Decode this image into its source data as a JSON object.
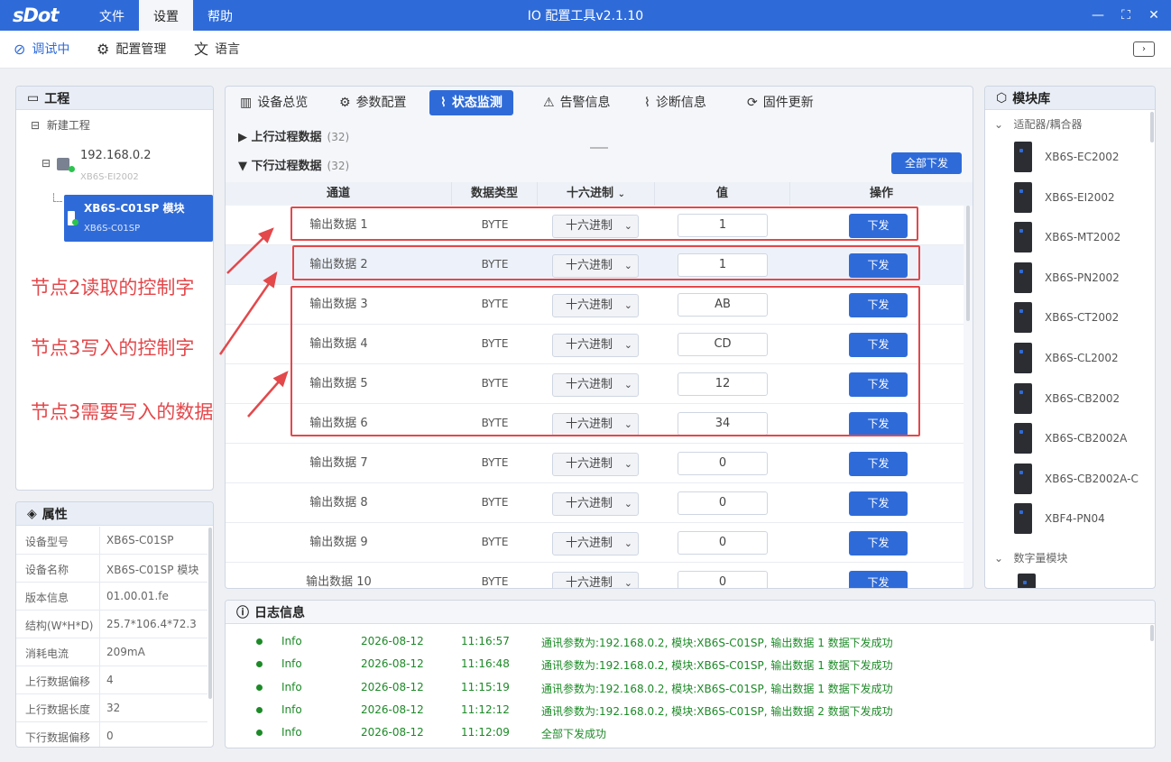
{
  "app": {
    "logo": "sDot",
    "title": "IO 配置工具v2.1.10",
    "menus": [
      "文件",
      "设置",
      "帮助"
    ],
    "active_menu": "设置"
  },
  "toolbar": {
    "debug": "调试中",
    "config_mgmt": "配置管理",
    "language": "语言"
  },
  "project": {
    "title": "工程",
    "root": "新建工程",
    "gateway_ip": "192.168.0.2",
    "gateway_model": "XB6S-EI2002",
    "selected_name": "XB6S-C01SP 模块",
    "selected_model": "XB6S-C01SP"
  },
  "properties": {
    "title": "属性",
    "rows": [
      {
        "k": "设备型号",
        "v": "XB6S-C01SP"
      },
      {
        "k": "设备名称",
        "v": "XB6S-C01SP 模块"
      },
      {
        "k": "版本信息",
        "v": "01.00.01.fe"
      },
      {
        "k": "结构(W*H*D)",
        "v": "25.7*106.4*72.3"
      },
      {
        "k": "消耗电流",
        "v": "209mA"
      },
      {
        "k": "上行数据偏移",
        "v": "4"
      },
      {
        "k": "上行数据长度",
        "v": "32"
      },
      {
        "k": "下行数据偏移",
        "v": "0"
      }
    ]
  },
  "tabs": [
    "设备总览",
    "参数配置",
    "状态监测",
    "告警信息",
    "诊断信息",
    "固件更新"
  ],
  "active_tab": "状态监测",
  "upstream": {
    "label": "上行过程数据",
    "count": "(32)"
  },
  "downstream": {
    "label": "下行过程数据",
    "count": "(32)",
    "send_all": "全部下发"
  },
  "table": {
    "headers": [
      "通道",
      "数据类型",
      "十六进制",
      "值",
      "操作"
    ],
    "rows": [
      {
        "ch": "输出数据 1",
        "type": "BYTE",
        "fmt": "十六进制",
        "val": "1",
        "op": "下发"
      },
      {
        "ch": "输出数据 2",
        "type": "BYTE",
        "fmt": "十六进制",
        "val": "1",
        "op": "下发"
      },
      {
        "ch": "输出数据 3",
        "type": "BYTE",
        "fmt": "十六进制",
        "val": "AB",
        "op": "下发"
      },
      {
        "ch": "输出数据 4",
        "type": "BYTE",
        "fmt": "十六进制",
        "val": "CD",
        "op": "下发"
      },
      {
        "ch": "输出数据 5",
        "type": "BYTE",
        "fmt": "十六进制",
        "val": "12",
        "op": "下发"
      },
      {
        "ch": "输出数据 6",
        "type": "BYTE",
        "fmt": "十六进制",
        "val": "34",
        "op": "下发"
      },
      {
        "ch": "输出数据 7",
        "type": "BYTE",
        "fmt": "十六进制",
        "val": "0",
        "op": "下发"
      },
      {
        "ch": "输出数据 8",
        "type": "BYTE",
        "fmt": "十六进制",
        "val": "0",
        "op": "下发"
      },
      {
        "ch": "输出数据 9",
        "type": "BYTE",
        "fmt": "十六进制",
        "val": "0",
        "op": "下发"
      },
      {
        "ch": "输出数据 10",
        "type": "BYTE",
        "fmt": "十六进制",
        "val": "0",
        "op": "下发"
      }
    ]
  },
  "annotations": [
    "节点2读取的控制字",
    "节点3写入的控制字",
    "节点3需要写入的数据"
  ],
  "library": {
    "title": "模块库",
    "group1": "适配器/耦合器",
    "items": [
      "XB6S-EC2002",
      "XB6S-EI2002",
      "XB6S-MT2002",
      "XB6S-PN2002",
      "XB6S-CT2002",
      "XB6S-CL2002",
      "XB6S-CB2002",
      "XB6S-CB2002A",
      "XB6S-CB2002A-C",
      "XBF4-PN04"
    ],
    "group2": "数字量模块"
  },
  "log": {
    "title": "日志信息",
    "rows": [
      {
        "level": "Info",
        "date": "2026-08-12",
        "time": "11:16:57",
        "msg": "通讯参数为:192.168.0.2, 模块:XB6S-C01SP, 输出数据 1 数据下发成功"
      },
      {
        "level": "Info",
        "date": "2026-08-12",
        "time": "11:16:48",
        "msg": "通讯参数为:192.168.0.2, 模块:XB6S-C01SP, 输出数据 1 数据下发成功"
      },
      {
        "level": "Info",
        "date": "2026-08-12",
        "time": "11:15:19",
        "msg": "通讯参数为:192.168.0.2, 模块:XB6S-C01SP, 输出数据 1 数据下发成功"
      },
      {
        "level": "Info",
        "date": "2026-08-12",
        "time": "11:12:12",
        "msg": "通讯参数为:192.168.0.2, 模块:XB6S-C01SP, 输出数据 2 数据下发成功"
      },
      {
        "level": "Info",
        "date": "2026-08-12",
        "time": "11:12:09",
        "msg": "全部下发成功"
      }
    ]
  },
  "colors": {
    "accent": "#2f6bd8",
    "annotation": "#e3484b",
    "log": "#1c8a27"
  }
}
